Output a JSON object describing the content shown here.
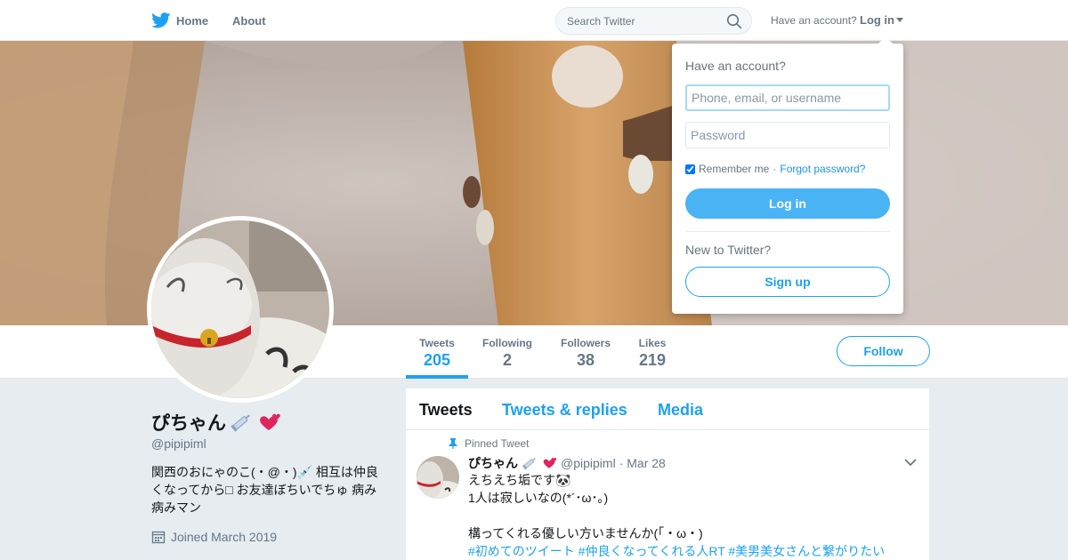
{
  "colors": {
    "accent": "#1da1f2",
    "background": "#e6ecf0",
    "text_muted": "#657786"
  },
  "topnav": {
    "home_label": "Home",
    "about_label": "About",
    "search_placeholder": "Search Twitter",
    "have_account_label": "Have an account?",
    "login_label": "Log in"
  },
  "profile_nav": {
    "stats": [
      {
        "label": "Tweets",
        "value": "205"
      },
      {
        "label": "Following",
        "value": "2"
      },
      {
        "label": "Followers",
        "value": "38"
      },
      {
        "label": "Likes",
        "value": "219"
      }
    ],
    "follow_label": "Follow"
  },
  "profile": {
    "name": "ぴちゃん",
    "handle": "@pipipiml",
    "bio": "関西のおにゃのこ(・@・)💉 相互は仲良くなってから□ お友達ぼちいでちゅ 病み病みマン",
    "joined": "Joined March 2019"
  },
  "timeline": {
    "tabs": [
      "Tweets",
      "Tweets & replies",
      "Media"
    ],
    "pinned_label": "Pinned Tweet",
    "tweet": {
      "name": "ぴちゃん",
      "handle": "@pipipiml",
      "time": "· Mar 28",
      "line1": "えちえち垢です🐼",
      "line2": "1人は寂しいなの(*´･ω･｡)",
      "line3": "構ってくれる優しい方いませんか(「・ω・)",
      "hashtags": "#初めてのツイート #仲良くなってくれる人RT #美男美女さんと繋がりたい"
    }
  },
  "login_dropdown": {
    "title": "Have an account?",
    "username_placeholder": "Phone, email, or username",
    "password_placeholder": "Password",
    "remember_label": "Remember me",
    "separator": "·",
    "forgot_label": "Forgot password?",
    "login_button": "Log in",
    "new_label": "New to Twitter?",
    "signup_button": "Sign up"
  }
}
